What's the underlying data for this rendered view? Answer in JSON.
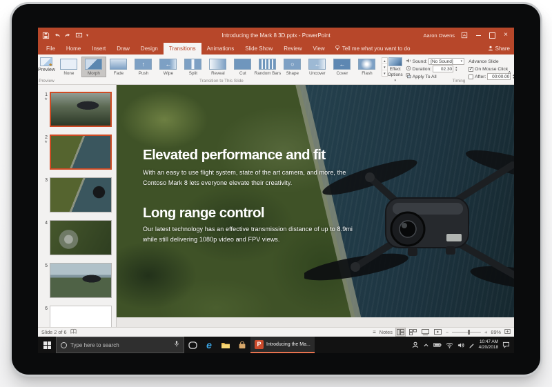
{
  "titlebar": {
    "title": "Introducing the Mark 8 3D.pptx - PowerPoint",
    "user_name": "Aaron Owens"
  },
  "tabs": {
    "items": [
      "File",
      "Home",
      "Insert",
      "Draw",
      "Design",
      "Transitions",
      "Animations",
      "Slide Show",
      "Review",
      "View"
    ],
    "active": "Transitions",
    "tell_me": "Tell me what you want to do",
    "share_label": "Share"
  },
  "ribbon": {
    "preview_label": "Preview",
    "preview_group_label": "Preview",
    "gallery": {
      "items": [
        {
          "label": "None",
          "glyph": ""
        },
        {
          "label": "Morph",
          "glyph": ""
        },
        {
          "label": "Fade",
          "glyph": ""
        },
        {
          "label": "Push",
          "glyph": "↑"
        },
        {
          "label": "Wipe",
          "glyph": "←"
        },
        {
          "label": "Split",
          "glyph": ""
        },
        {
          "label": "Reveal",
          "glyph": ""
        },
        {
          "label": "Cut",
          "glyph": ""
        },
        {
          "label": "Random Bars",
          "glyph": ""
        },
        {
          "label": "Shape",
          "glyph": "○"
        },
        {
          "label": "Uncover",
          "glyph": "←"
        },
        {
          "label": "Cover",
          "glyph": "←"
        },
        {
          "label": "Flash",
          "glyph": ""
        }
      ],
      "selected": "Morph",
      "group_label": "Transition to This Slide"
    },
    "effect_options_label": "Effect Options",
    "timing": {
      "sound_label": "Sound:",
      "sound_value": "[No Sound]",
      "duration_label": "Duration:",
      "duration_value": "02.30",
      "apply_to_all_label": "Apply To All",
      "advance_slide_label": "Advance Slide",
      "on_mouse_click_label": "On Mouse Click",
      "on_mouse_click_checked": true,
      "after_label": "After:",
      "after_value": "00:00.00",
      "after_checked": false,
      "group_label": "Timing"
    }
  },
  "thumbnails": {
    "slides": [
      {
        "num": "1",
        "starred": true,
        "selected": true,
        "kind": "title"
      },
      {
        "num": "2",
        "starred": true,
        "selected": true,
        "kind": "aerial"
      },
      {
        "num": "3",
        "starred": false,
        "selected": false,
        "kind": "aerial-drone"
      },
      {
        "num": "4",
        "starred": false,
        "selected": false,
        "kind": "camera"
      },
      {
        "num": "5",
        "starred": false,
        "selected": false,
        "kind": "mountain"
      },
      {
        "num": "6",
        "starred": false,
        "selected": false,
        "kind": "blank"
      }
    ]
  },
  "slide": {
    "heading1": "Elevated performance and fit",
    "body1": "With an easy to use flight system, state of the art camera, and more, the Contoso Mark 8 lets everyone elevate their creativity.",
    "heading2": "Long range control",
    "body2": "Our latest technology has an effective transmission distance of up to 8.9mi while still delivering 1080p video and FPV views."
  },
  "statusbar": {
    "slide_indicator": "Slide 2 of 6",
    "notes_label": "Notes",
    "zoom_percent": "89%"
  },
  "taskbar": {
    "search_placeholder": "Type here to search",
    "ppt_button_label": "Introducing the Ma...",
    "time": "10:47 AM",
    "date": "4/20/2018"
  },
  "colors": {
    "accent_orange": "#b7472a",
    "selection_orange": "#cf4b24",
    "gallery_blue": "#7da0c4",
    "taskbar_black": "#121212"
  },
  "icons": {
    "qat": [
      "save-icon",
      "undo-icon",
      "redo-icon",
      "start-slideshow-icon",
      "qat-dropdown-icon"
    ],
    "titlebar": [
      "ribbon-display-options-icon",
      "minimize-icon",
      "restore-icon",
      "close-icon"
    ],
    "taskbar": [
      "start-icon",
      "cortana-ring-icon",
      "microphone-icon",
      "task-view-icon",
      "edge-icon",
      "file-explorer-icon",
      "store-icon",
      "powerpoint-icon"
    ],
    "tray": [
      "people-icon",
      "chevron-up-icon",
      "battery-icon",
      "wifi-icon",
      "volume-icon",
      "pen-icon",
      "action-center-icon"
    ]
  }
}
